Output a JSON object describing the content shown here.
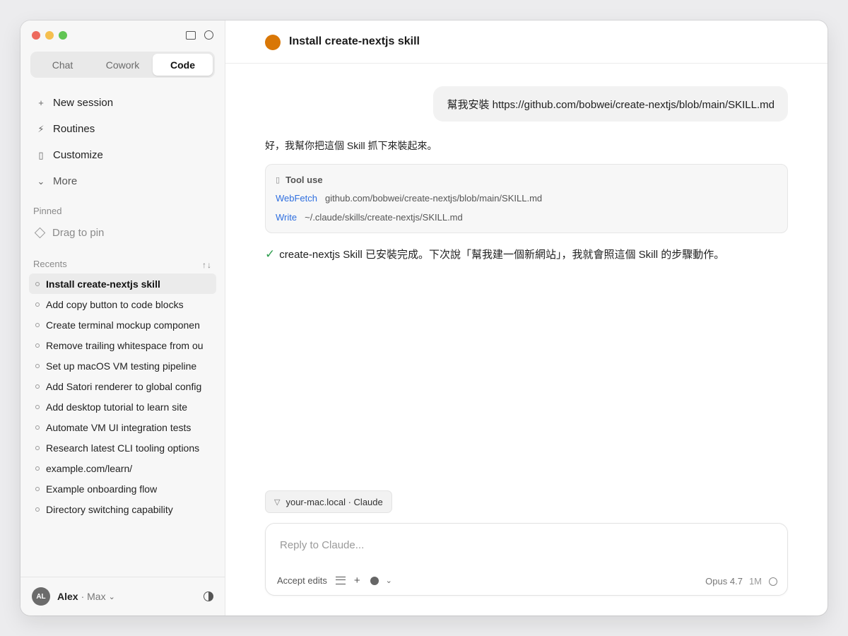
{
  "sidebar": {
    "modes": [
      "Chat",
      "Cowork",
      "Code"
    ],
    "active_mode": "Code",
    "nav": [
      {
        "icon": "plus-icon",
        "glyph": "+",
        "label": "New session"
      },
      {
        "icon": "lightning-icon",
        "glyph": "⚡",
        "label": "Routines"
      },
      {
        "icon": "book-icon",
        "glyph": "▯",
        "label": "Customize"
      },
      {
        "icon": "chevron-down-icon",
        "glyph": "⌄",
        "label": "More"
      }
    ],
    "pinned_label": "Pinned",
    "pin_placeholder": "Drag to pin",
    "recents_label": "Recents",
    "recents": [
      "Install create-nextjs skill",
      "Add copy button to code blocks",
      "Create terminal mockup componen",
      "Remove trailing whitespace from ou",
      "Set up macOS VM testing pipeline",
      "Add Satori renderer to global config",
      "Add desktop tutorial to learn site",
      "Automate VM UI integration tests",
      "Research latest CLI tooling options",
      "example.com/learn/",
      "Example onboarding flow",
      "Directory switching capability"
    ],
    "user": {
      "initials": "AL",
      "name": "Alex",
      "plan": "· Max"
    }
  },
  "session": {
    "title": "Install create-nextjs skill",
    "status_color": "#d97706"
  },
  "messages": {
    "user": "幫我安裝 https://github.com/bobwei/create-nextjs/blob/main/SKILL.md",
    "assistant_intro": "好，我幫你把這個 Skill 抓下來裝起來。",
    "tool_use": {
      "label": "Tool use",
      "calls": [
        {
          "tool": "WebFetch",
          "arg": "github.com/bobwei/create-nextjs/blob/main/SKILL.md"
        },
        {
          "tool": "Write",
          "arg": "~/.claude/skills/create-nextjs/SKILL.md"
        }
      ]
    },
    "assistant_done": "create-nextjs Skill 已安裝完成。下次說「幫我建一個新網站」，我就會照這個 Skill 的步驟動作。"
  },
  "environment": {
    "label": "your-mac.local · Claude"
  },
  "composer": {
    "placeholder": "Reply to Claude...",
    "value": "",
    "mode_label": "Accept edits",
    "model": "Opus 4.7",
    "context": "1M"
  }
}
